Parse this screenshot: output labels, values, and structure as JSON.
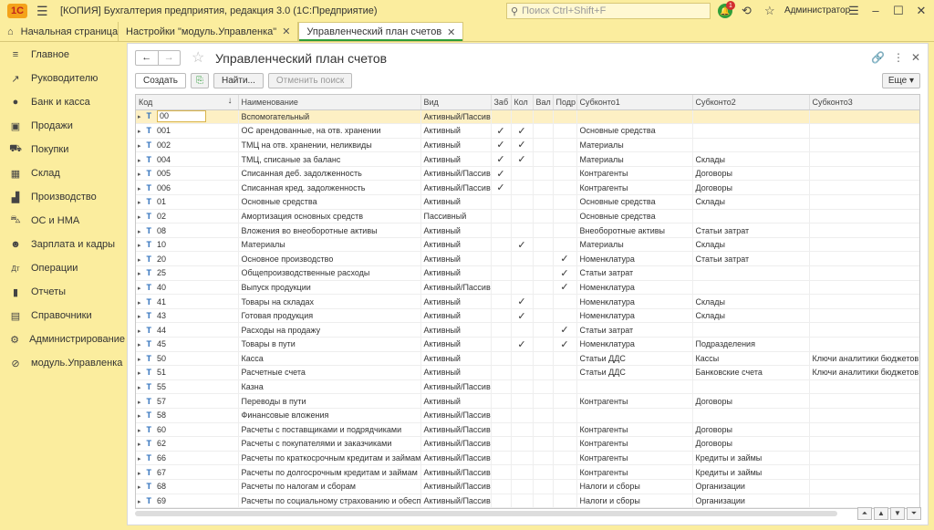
{
  "titlebar": {
    "logo": "1С",
    "title": "[КОПИЯ] Бухгалтерия предприятия, редакция 3.0  (1С:Предприятие)",
    "search_placeholder": "Поиск Ctrl+Shift+F",
    "notif_count": "1",
    "user": "Администратор"
  },
  "tabs": [
    {
      "label": "Начальная страница"
    },
    {
      "label": "Настройки \"модуль.Управленка\""
    },
    {
      "label": "Управленческий план счетов"
    }
  ],
  "sidebar": {
    "items": [
      {
        "label": "Главное",
        "icon": "menu-icon"
      },
      {
        "label": "Руководителю",
        "icon": "chart-line-icon"
      },
      {
        "label": "Банк и касса",
        "icon": "coin-icon"
      },
      {
        "label": "Продажи",
        "icon": "bag-icon"
      },
      {
        "label": "Покупки",
        "icon": "cart-icon"
      },
      {
        "label": "Склад",
        "icon": "warehouse-icon"
      },
      {
        "label": "Производство",
        "icon": "factory-icon"
      },
      {
        "label": "ОС и НМА",
        "icon": "truck-icon"
      },
      {
        "label": "Зарплата и кадры",
        "icon": "person-icon"
      },
      {
        "label": "Операции",
        "icon": "dt-kt-icon"
      },
      {
        "label": "Отчеты",
        "icon": "bar-chart-icon"
      },
      {
        "label": "Справочники",
        "icon": "book-icon"
      },
      {
        "label": "Администрирование",
        "icon": "gear-icon"
      },
      {
        "label": "модуль.Управленка",
        "icon": "link-icon"
      }
    ]
  },
  "main": {
    "title": "Управленческий план счетов",
    "buttons": {
      "create": "Создать",
      "find": "Найти...",
      "cancel_search": "Отменить поиск",
      "more": "Еще"
    },
    "columns": [
      "Код",
      "Наименование",
      "Вид",
      "Заб",
      "Кол",
      "Вал",
      "Подр",
      "Субконто1",
      "Субконто2",
      "Субконто3"
    ],
    "rows": [
      {
        "code": "00",
        "name": "Вспомогательный",
        "kind": "Активный/Пассив...",
        "zab": "",
        "kol": "",
        "val": "",
        "podr": "",
        "s1": "",
        "s2": "",
        "s3": ""
      },
      {
        "code": "001",
        "name": "ОС арендованные, на отв. хранении",
        "kind": "Активный",
        "zab": "✓",
        "kol": "✓",
        "val": "",
        "podr": "",
        "s1": "Основные средства",
        "s2": "",
        "s3": ""
      },
      {
        "code": "002",
        "name": "ТМЦ на отв. хранении, неликвиды",
        "kind": "Активный",
        "zab": "✓",
        "kol": "✓",
        "val": "",
        "podr": "",
        "s1": "Материалы",
        "s2": "",
        "s3": ""
      },
      {
        "code": "004",
        "name": "ТМЦ, списаные за баланс",
        "kind": "Активный",
        "zab": "✓",
        "kol": "✓",
        "val": "",
        "podr": "",
        "s1": "Материалы",
        "s2": "Склады",
        "s3": ""
      },
      {
        "code": "005",
        "name": "Списанная деб. задолженность",
        "kind": "Активный/Пассив...",
        "zab": "✓",
        "kol": "",
        "val": "",
        "podr": "",
        "s1": "Контрагенты",
        "s2": "Договоры",
        "s3": ""
      },
      {
        "code": "006",
        "name": "Списанная кред. задолженность",
        "kind": "Активный/Пассив...",
        "zab": "✓",
        "kol": "",
        "val": "",
        "podr": "",
        "s1": "Контрагенты",
        "s2": "Договоры",
        "s3": ""
      },
      {
        "code": "01",
        "name": "Основные средства",
        "kind": "Активный",
        "zab": "",
        "kol": "",
        "val": "",
        "podr": "",
        "s1": "Основные средства",
        "s2": "Склады",
        "s3": ""
      },
      {
        "code": "02",
        "name": "Амортизация основных средств",
        "kind": "Пассивный",
        "zab": "",
        "kol": "",
        "val": "",
        "podr": "",
        "s1": "Основные средства",
        "s2": "",
        "s3": ""
      },
      {
        "code": "08",
        "name": "Вложения во внеоборотные активы",
        "kind": "Активный",
        "zab": "",
        "kol": "",
        "val": "",
        "podr": "",
        "s1": "Внеоборотные активы",
        "s2": "Статьи затрат",
        "s3": ""
      },
      {
        "code": "10",
        "name": "Материалы",
        "kind": "Активный",
        "zab": "",
        "kol": "✓",
        "val": "",
        "podr": "",
        "s1": "Материалы",
        "s2": "Склады",
        "s3": ""
      },
      {
        "code": "20",
        "name": "Основное производство",
        "kind": "Активный",
        "zab": "",
        "kol": "",
        "val": "",
        "podr": "✓",
        "s1": "Номенклатура",
        "s2": "Статьи затрат",
        "s3": ""
      },
      {
        "code": "25",
        "name": "Общепроизводственные расходы",
        "kind": "Активный",
        "zab": "",
        "kol": "",
        "val": "",
        "podr": "✓",
        "s1": "Статьи затрат",
        "s2": "",
        "s3": ""
      },
      {
        "code": "40",
        "name": "Выпуск продукции",
        "kind": "Активный/Пассив...",
        "zab": "",
        "kol": "",
        "val": "",
        "podr": "✓",
        "s1": "Номенклатура",
        "s2": "",
        "s3": ""
      },
      {
        "code": "41",
        "name": "Товары на складах",
        "kind": "Активный",
        "zab": "",
        "kol": "✓",
        "val": "",
        "podr": "",
        "s1": "Номенклатура",
        "s2": "Склады",
        "s3": ""
      },
      {
        "code": "43",
        "name": "Готовая продукция",
        "kind": "Активный",
        "zab": "",
        "kol": "✓",
        "val": "",
        "podr": "",
        "s1": "Номенклатура",
        "s2": "Склады",
        "s3": ""
      },
      {
        "code": "44",
        "name": "Расходы на продажу",
        "kind": "Активный",
        "zab": "",
        "kol": "",
        "val": "",
        "podr": "✓",
        "s1": "Статьи затрат",
        "s2": "",
        "s3": ""
      },
      {
        "code": "45",
        "name": "Товары в пути",
        "kind": "Активный",
        "zab": "",
        "kol": "✓",
        "val": "",
        "podr": "✓",
        "s1": "Номенклатура",
        "s2": "Подразделения",
        "s3": ""
      },
      {
        "code": "50",
        "name": "Касса",
        "kind": "Активный",
        "zab": "",
        "kol": "",
        "val": "",
        "podr": "",
        "s1": "Статьи ДДС",
        "s2": "Кассы",
        "s3": "Ключи аналитики бюджетов"
      },
      {
        "code": "51",
        "name": "Расчетные счета",
        "kind": "Активный",
        "zab": "",
        "kol": "",
        "val": "",
        "podr": "",
        "s1": "Статьи ДДС",
        "s2": "Банковские счета",
        "s3": "Ключи аналитики бюджетов"
      },
      {
        "code": "55",
        "name": "Казна",
        "kind": "Активный/Пассив...",
        "zab": "",
        "kol": "",
        "val": "",
        "podr": "",
        "s1": "",
        "s2": "",
        "s3": ""
      },
      {
        "code": "57",
        "name": "Переводы в пути",
        "kind": "Активный",
        "zab": "",
        "kol": "",
        "val": "",
        "podr": "",
        "s1": "Контрагенты",
        "s2": "Договоры",
        "s3": ""
      },
      {
        "code": "58",
        "name": "Финансовые вложения",
        "kind": "Активный/Пассив...",
        "zab": "",
        "kol": "",
        "val": "",
        "podr": "",
        "s1": "",
        "s2": "",
        "s3": ""
      },
      {
        "code": "60",
        "name": "Расчеты с поставщиками и подрядчиками",
        "kind": "Активный/Пассив...",
        "zab": "",
        "kol": "",
        "val": "",
        "podr": "",
        "s1": "Контрагенты",
        "s2": "Договоры",
        "s3": ""
      },
      {
        "code": "62",
        "name": "Расчеты с покупателями и заказчиками",
        "kind": "Активный/Пассив...",
        "zab": "",
        "kol": "",
        "val": "",
        "podr": "",
        "s1": "Контрагенты",
        "s2": "Договоры",
        "s3": ""
      },
      {
        "code": "66",
        "name": "Расчеты по краткосрочным кредитам и займам",
        "kind": "Активный/Пассив...",
        "zab": "",
        "kol": "",
        "val": "",
        "podr": "",
        "s1": "Контрагенты",
        "s2": "Кредиты и займы",
        "s3": ""
      },
      {
        "code": "67",
        "name": "Расчеты по долгосрочным кредитам и займам",
        "kind": "Активный/Пассив...",
        "zab": "",
        "kol": "",
        "val": "",
        "podr": "",
        "s1": "Контрагенты",
        "s2": "Кредиты и займы",
        "s3": ""
      },
      {
        "code": "68",
        "name": "Расчеты по налогам и сборам",
        "kind": "Активный/Пассив...",
        "zab": "",
        "kol": "",
        "val": "",
        "podr": "",
        "s1": "Налоги и сборы",
        "s2": "Организации",
        "s3": ""
      },
      {
        "code": "69",
        "name": "Расчеты по социальному страхованию и обесп...",
        "kind": "Активный/Пассив...",
        "zab": "",
        "kol": "",
        "val": "",
        "podr": "",
        "s1": "Налоги и сборы",
        "s2": "Организации",
        "s3": ""
      }
    ]
  }
}
